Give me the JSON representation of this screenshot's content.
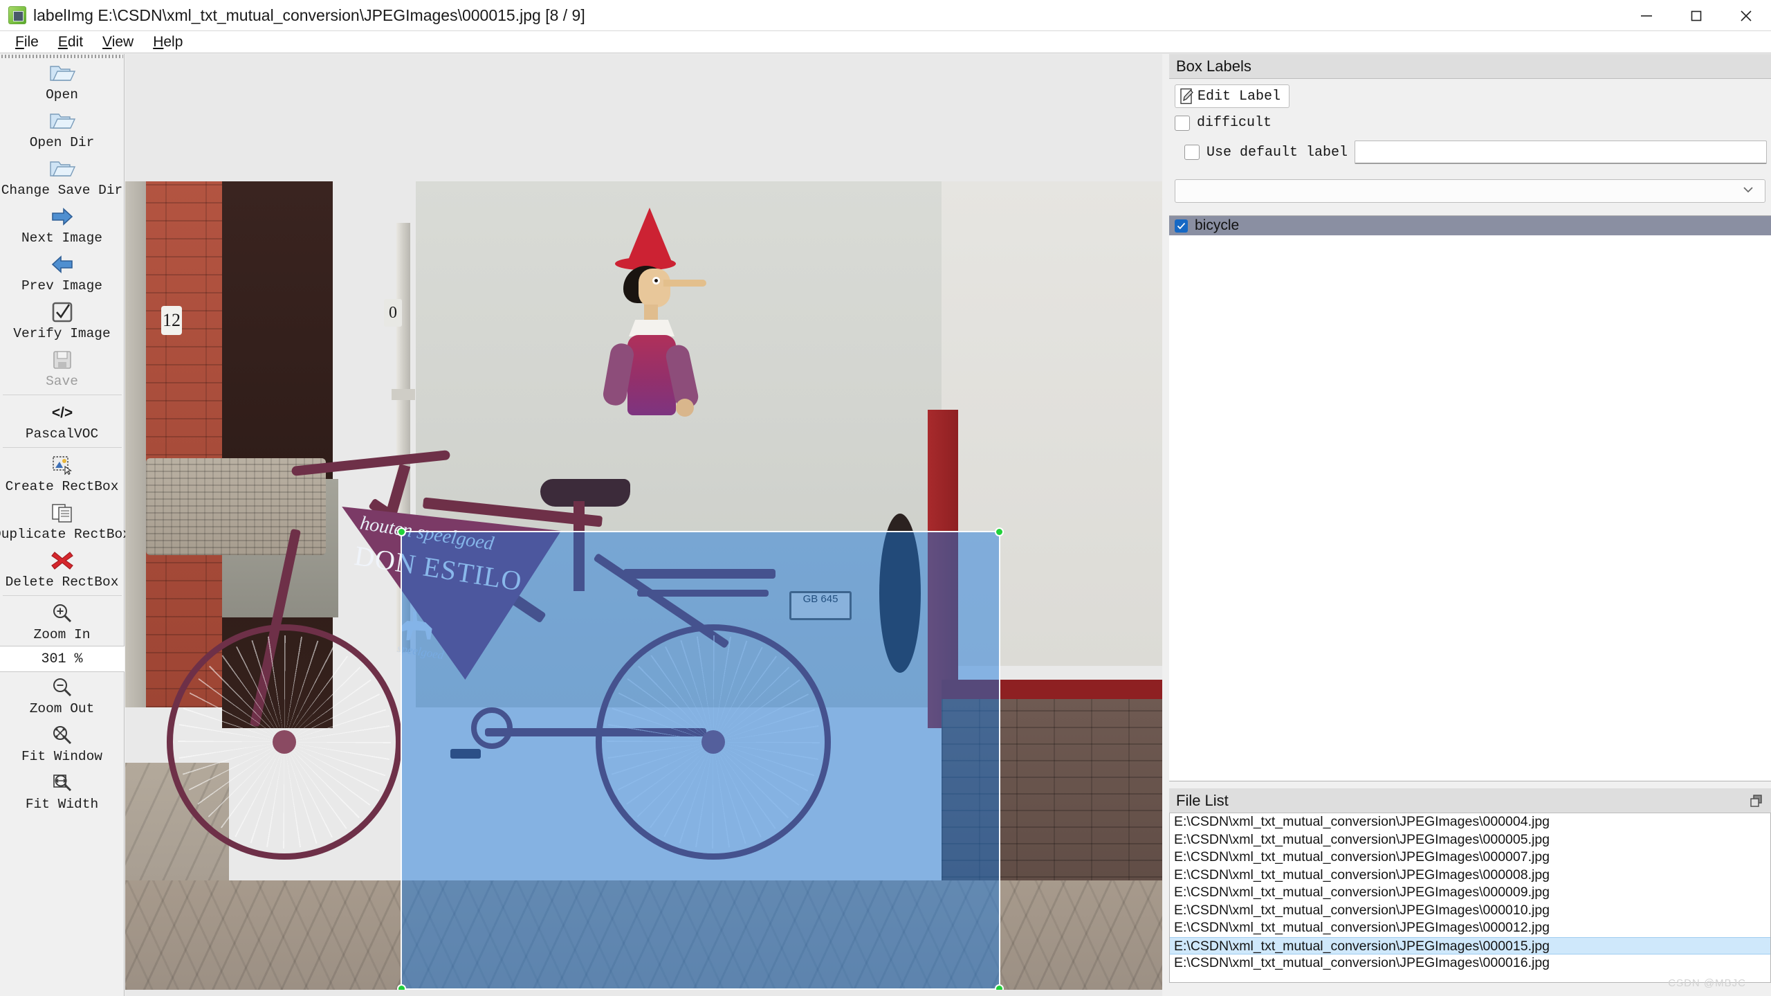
{
  "window": {
    "title": "labelImg E:\\CSDN\\xml_txt_mutual_conversion\\JPEGImages\\000015.jpg [8 / 9]",
    "app_icon": "labelimg-logo-icon",
    "minimize": "minimize-icon",
    "maximize": "maximize-icon",
    "close": "close-icon"
  },
  "menubar": {
    "items": [
      {
        "accel": "F",
        "rest": "ile"
      },
      {
        "accel": "E",
        "rest": "dit"
      },
      {
        "accel": "V",
        "rest": "iew"
      },
      {
        "accel": "H",
        "rest": "elp"
      }
    ]
  },
  "toolbar": {
    "items": [
      {
        "label": "Open",
        "icon": "open-folder-icon",
        "disabled": false
      },
      {
        "label": "Open Dir",
        "icon": "open-folder-icon",
        "disabled": false
      },
      {
        "label": "Change Save Dir",
        "icon": "open-folder-icon",
        "disabled": false
      },
      {
        "label": "Next Image",
        "icon": "arrow-right-icon",
        "disabled": false
      },
      {
        "label": "Prev Image",
        "icon": "arrow-left-icon",
        "disabled": false
      },
      {
        "label": "Verify Image",
        "icon": "checkbox-tick-icon",
        "disabled": false
      },
      {
        "label": "Save",
        "icon": "floppy-disk-icon",
        "disabled": true
      },
      {
        "label": "PascalVOC",
        "icon": "code-tags-icon",
        "disabled": false
      },
      {
        "label": "Create RectBox",
        "icon": "create-rectbox-icon",
        "disabled": false
      },
      {
        "label": "Duplicate RectBox",
        "icon": "duplicate-rectbox-icon",
        "disabled": false
      },
      {
        "label": "Delete RectBox",
        "icon": "red-x-icon",
        "disabled": false
      },
      {
        "label": "Zoom In",
        "icon": "zoom-in-icon",
        "disabled": false
      },
      {
        "label": "Zoom Out",
        "icon": "zoom-out-icon",
        "disabled": false
      },
      {
        "label": "Fit Window",
        "icon": "fit-window-icon",
        "disabled": false
      },
      {
        "label": "Fit Width",
        "icon": "fit-width-icon",
        "disabled": false
      }
    ],
    "zoom_value": "301 %"
  },
  "box_labels_panel": {
    "title": "Box Labels",
    "edit_label_button": "Edit Label",
    "difficult_checkbox": {
      "label": "difficult",
      "checked": false
    },
    "use_default_label": {
      "label": "Use default label",
      "checked": false
    },
    "default_label_value": "",
    "combo_value": "",
    "labels": [
      {
        "text": "bicycle",
        "checked": true,
        "selected": true
      }
    ]
  },
  "file_list_panel": {
    "title": "File List",
    "float_icon": "float-undock-icon",
    "files": [
      {
        "path": "E:\\CSDN\\xml_txt_mutual_conversion\\JPEGImages\\000004.jpg",
        "selected": false
      },
      {
        "path": "E:\\CSDN\\xml_txt_mutual_conversion\\JPEGImages\\000005.jpg",
        "selected": false
      },
      {
        "path": "E:\\CSDN\\xml_txt_mutual_conversion\\JPEGImages\\000007.jpg",
        "selected": false
      },
      {
        "path": "E:\\CSDN\\xml_txt_mutual_conversion\\JPEGImages\\000008.jpg",
        "selected": false
      },
      {
        "path": "E:\\CSDN\\xml_txt_mutual_conversion\\JPEGImages\\000009.jpg",
        "selected": false
      },
      {
        "path": "E:\\CSDN\\xml_txt_mutual_conversion\\JPEGImages\\000010.jpg",
        "selected": false
      },
      {
        "path": "E:\\CSDN\\xml_txt_mutual_conversion\\JPEGImages\\000012.jpg",
        "selected": false
      },
      {
        "path": "E:\\CSDN\\xml_txt_mutual_conversion\\JPEGImages\\000015.jpg",
        "selected": true
      },
      {
        "path": "E:\\CSDN\\xml_txt_mutual_conversion\\JPEGImages\\000016.jpg",
        "selected": false
      }
    ]
  },
  "canvas": {
    "house_number_left": "12",
    "house_number_mid": "0",
    "sign_line1": "houten speelgoed",
    "sign_line2": "DON ESTILO",
    "sign_line3": "speelgoed",
    "license_plate": "GB 645",
    "annotation": {
      "label": "bicycle",
      "fill_color": "#1a78dc",
      "handle_color": "#22d13a"
    }
  },
  "watermark": "CSDN @MBJC"
}
